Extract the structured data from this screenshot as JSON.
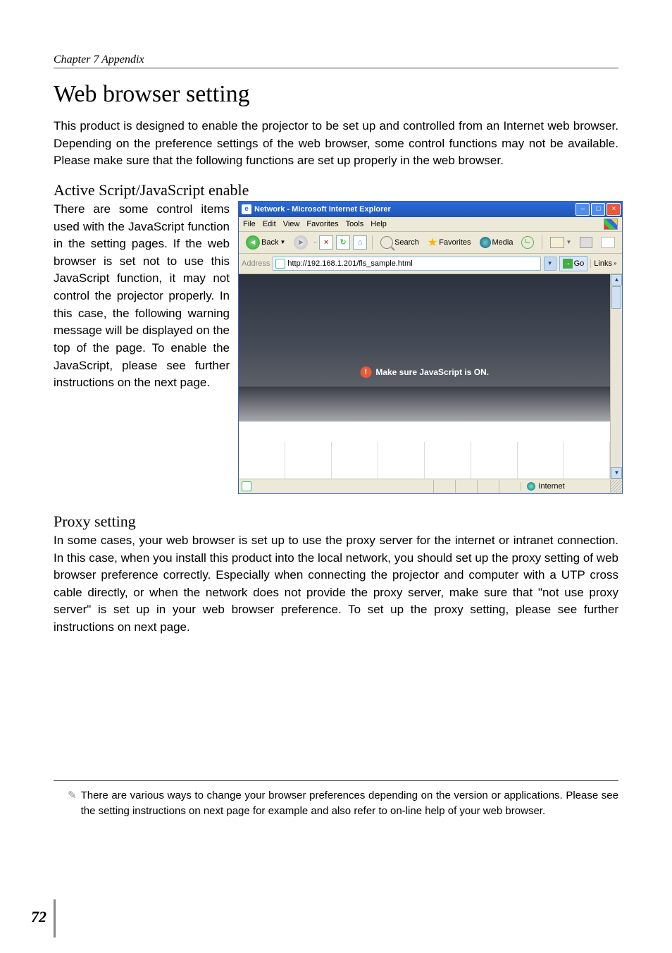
{
  "header": {
    "chapter": "Chapter 7 Appendix"
  },
  "title": "Web browser setting",
  "intro": "This product is designed to enable the projector to be set up and controlled from an Internet web browser. Depending on the preference settings of the web browser, some control functions may not be available. Please make sure that the following functions are set up properly in the web browser.",
  "section_js": {
    "heading": "Active Script/JavaScript enable",
    "body": "There are some control items used with the JavaScript function in the setting pages. If the web browser is set not to use this JavaScript function, it may not control the projector properly. In this case, the following warning message will be displayed on the top of the page. To enable the JavaScript, please see further instructions on the next page."
  },
  "ie": {
    "title": "Network - Microsoft Internet Explorer",
    "menus": [
      "File",
      "Edit",
      "View",
      "Favorites",
      "Tools",
      "Help"
    ],
    "toolbar": {
      "back": "Back",
      "search": "Search",
      "favorites": "Favorites",
      "media": "Media"
    },
    "address_label": "Address",
    "address_value": "http://192.168.1.201/fls_sample.html",
    "go_label": "Go",
    "links_label": "Links",
    "js_warning": "Make sure JavaScript is ON.",
    "status_zone": "Internet"
  },
  "section_proxy": {
    "heading": "Proxy setting",
    "body": "In some cases, your web browser is set up to use the proxy server for the internet or intranet connection. In this case, when you install this product into the local network, you should set up the proxy setting of web browser preference correctly. Especially when connecting the projector and computer with a UTP cross cable directly, or when the network does not provide the proxy server, make sure that \"not use proxy server\" is set up in your web browser preference. To set up the proxy setting, please see further instructions on next page."
  },
  "footnote": "There are various ways to change your browser preferences depending on the version or applications. Please see the setting instructions on next page for example and also refer to on-line help of your web browser.",
  "page_number": "72"
}
